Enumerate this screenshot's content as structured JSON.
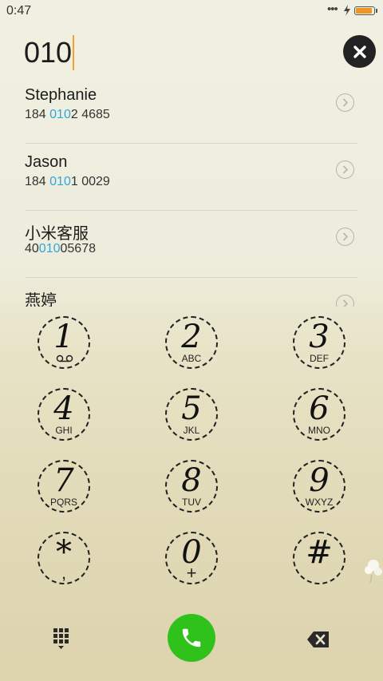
{
  "status_bar": {
    "time": "0:47",
    "dots": "•••",
    "battery_color": "#f0961f"
  },
  "dialer": {
    "input_value": "010",
    "caret_color": "#f5a12b"
  },
  "contacts": [
    {
      "name": "Stephanie",
      "number_prefix": "184 ",
      "number_match": "010",
      "number_suffix": "2 4685"
    },
    {
      "name": "Jason",
      "number_prefix": "184 ",
      "number_match": "010",
      "number_suffix": "1 0029"
    },
    {
      "name": "小米客服",
      "number_prefix": "40",
      "number_match": "010",
      "number_suffix": "05678"
    },
    {
      "name": "燕婷",
      "number_prefix": "",
      "number_match": "",
      "number_suffix": ""
    }
  ],
  "highlight_color": "#2fa7dc",
  "keypad": {
    "keys": [
      {
        "digit": "1",
        "letters": "",
        "sub_icon": "voicemail-icon"
      },
      {
        "digit": "2",
        "letters": "ABC"
      },
      {
        "digit": "3",
        "letters": "DEF"
      },
      {
        "digit": "4",
        "letters": "GHI"
      },
      {
        "digit": "5",
        "letters": "JKL"
      },
      {
        "digit": "6",
        "letters": "MNO"
      },
      {
        "digit": "7",
        "letters": "PQRS"
      },
      {
        "digit": "8",
        "letters": "TUV"
      },
      {
        "digit": "9",
        "letters": "WXYZ"
      },
      {
        "digit": "*",
        "letters": ",",
        "sub_text": ","
      },
      {
        "digit": "0",
        "letters": "+",
        "sub_text": "+"
      },
      {
        "digit": "#",
        "letters": ""
      }
    ]
  },
  "actions": {
    "call_color": "#2ec21a",
    "dialpad_icon": "dialpad-icon",
    "call_icon": "phone-icon",
    "backspace_icon": "backspace-icon"
  }
}
